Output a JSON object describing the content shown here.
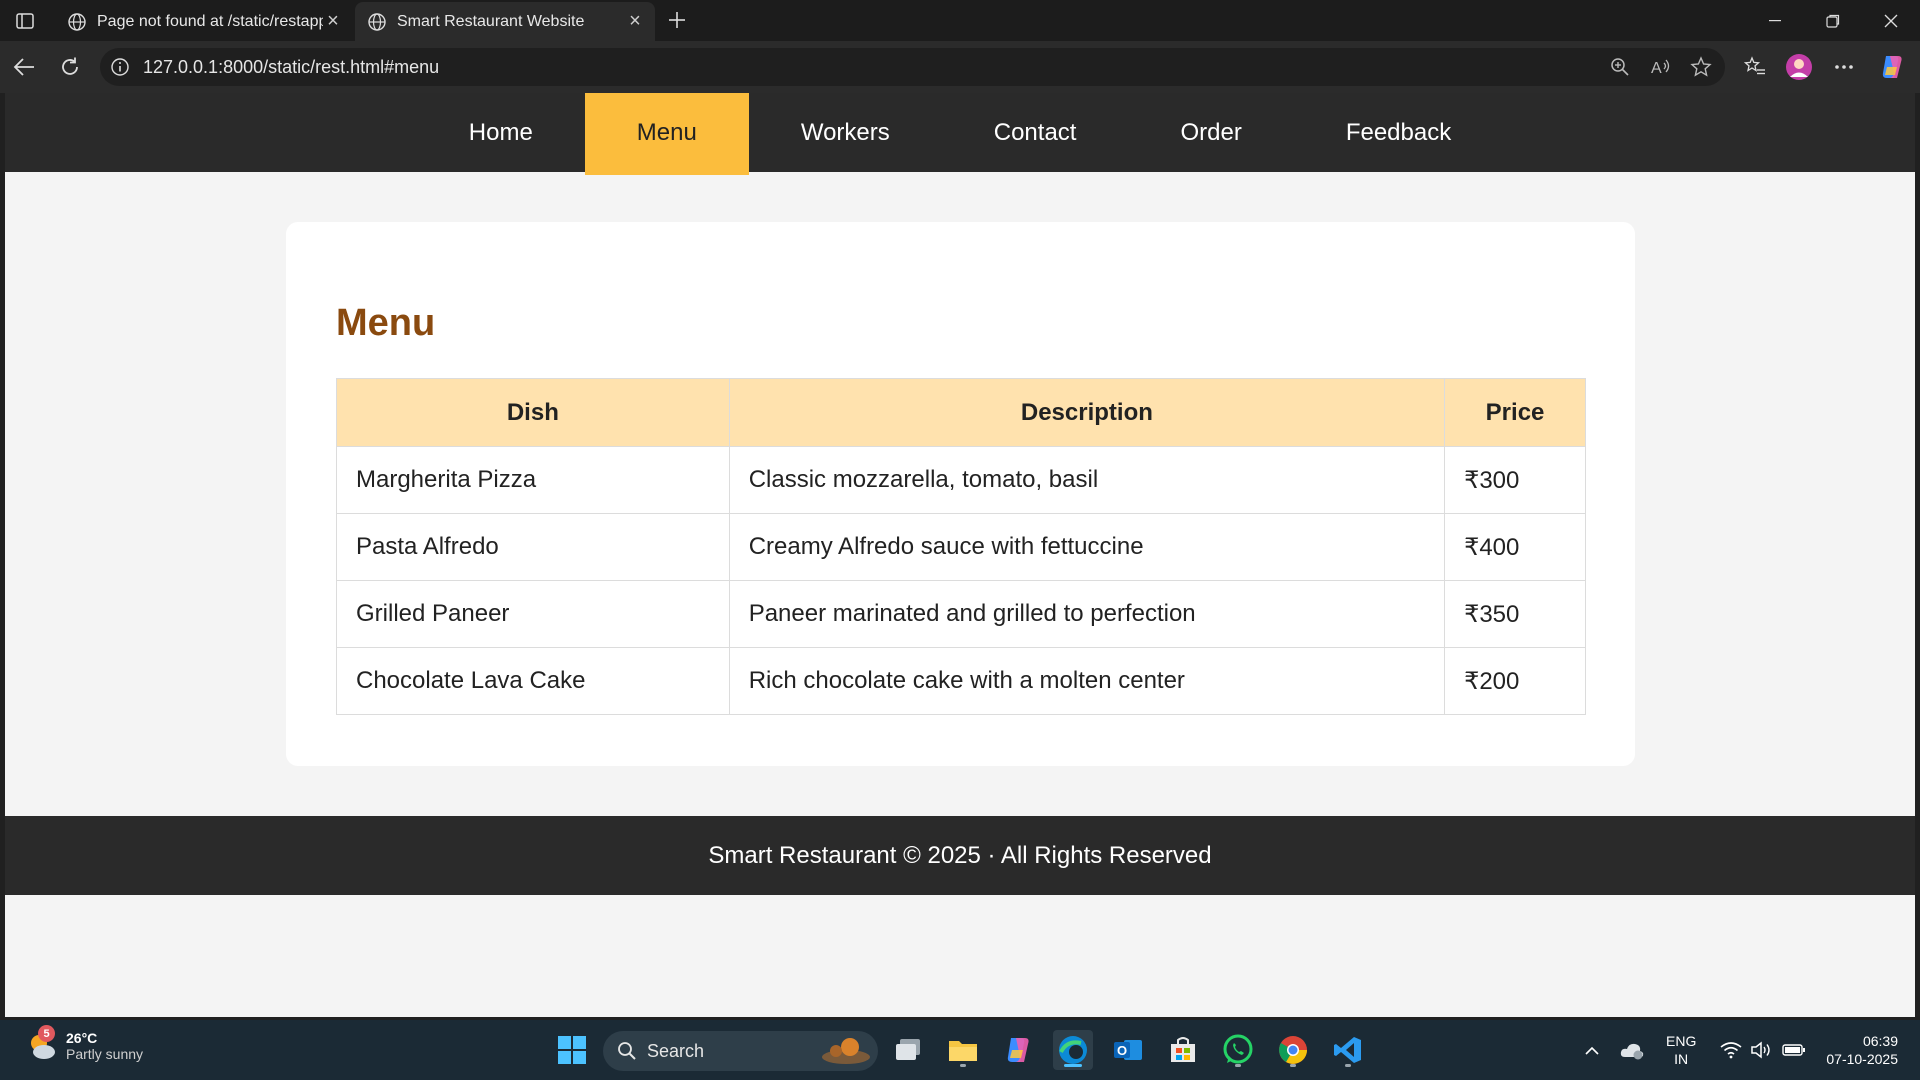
{
  "browser": {
    "tabs": [
      {
        "title": "Page not found at /static/restapp",
        "active": false
      },
      {
        "title": "Smart Restaurant Website",
        "active": true
      }
    ],
    "url": "127.0.0.1:8000/static/rest.html#menu"
  },
  "site": {
    "nav": [
      "Home",
      "Menu",
      "Workers",
      "Contact",
      "Order",
      "Feedback"
    ],
    "active_nav": "Menu",
    "accent_color": "#fbbd3d",
    "heading": "Menu",
    "table": {
      "headers": [
        "Dish",
        "Description",
        "Price"
      ],
      "rows": [
        [
          "Margherita Pizza",
          "Classic mozzarella, tomato, basil",
          "₹300"
        ],
        [
          "Pasta Alfredo",
          "Creamy Alfredo sauce with fettuccine",
          "₹400"
        ],
        [
          "Grilled Paneer",
          "Paneer marinated and grilled to perfection",
          "₹350"
        ],
        [
          "Chocolate Lava Cake",
          "Rich chocolate cake with a molten center",
          "₹200"
        ]
      ]
    },
    "footer": "Smart Restaurant © 2025 · All Rights Reserved"
  },
  "taskbar": {
    "weather": {
      "badge": "5",
      "temp": "26°C",
      "condition": "Partly sunny"
    },
    "search_label": "Search",
    "language": {
      "line1": "ENG",
      "line2": "IN"
    },
    "time": "06:39",
    "date": "07-10-2025"
  }
}
